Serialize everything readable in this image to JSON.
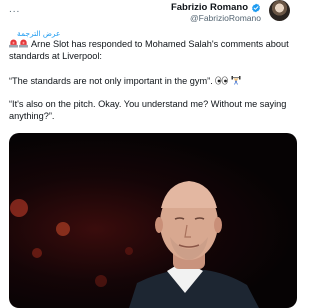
{
  "more_label": "...",
  "author": {
    "name": "Fabrizio Romano",
    "handle": "@FabrizioRomano"
  },
  "translate_label": "عرض الترجمة",
  "tweet": {
    "line1": "Arne Slot has responded to Mohamed Salah's comments about standards at Liverpool:",
    "line2": "“The standards are not only important in the gym”.",
    "line3": "“It's also on the pitch. Okay. You understand me? Without me saying anything?”."
  },
  "colors": {
    "link": "#1d9bf0",
    "muted": "#536471",
    "text": "#0f1419"
  },
  "icons": [
    "more-icon",
    "verified-icon",
    "siren-icon",
    "eyes-icon",
    "weightlifter-icon"
  ]
}
